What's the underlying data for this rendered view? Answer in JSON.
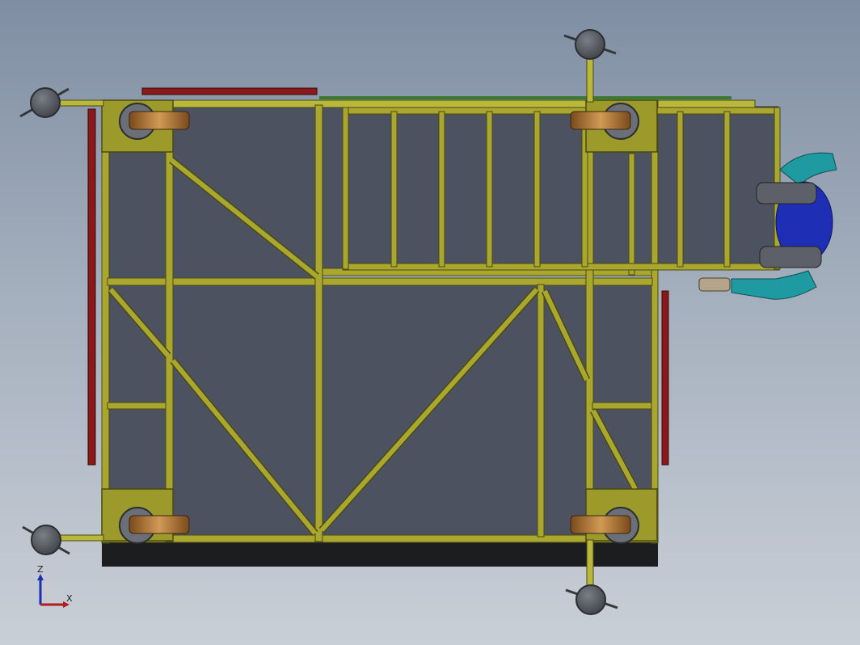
{
  "colors": {
    "frame": "#9c9a2a",
    "frame_light": "#c6c450",
    "frame_dark": "#4a4a10",
    "panel": "#4d5260",
    "base_band": "#1c1d1f",
    "red_bar": "#8a1a1a",
    "wheel_tire": "#b57a33",
    "wheel_hub": "#6b6f77",
    "leveler": "#55585f",
    "person_body": "#1f9aa0",
    "person_head": "#1f2fb5"
  },
  "icons": {
    "axis_triad": "xz-axis-triad-icon"
  },
  "triad": {
    "z_label": "Z",
    "x_label": "X"
  }
}
